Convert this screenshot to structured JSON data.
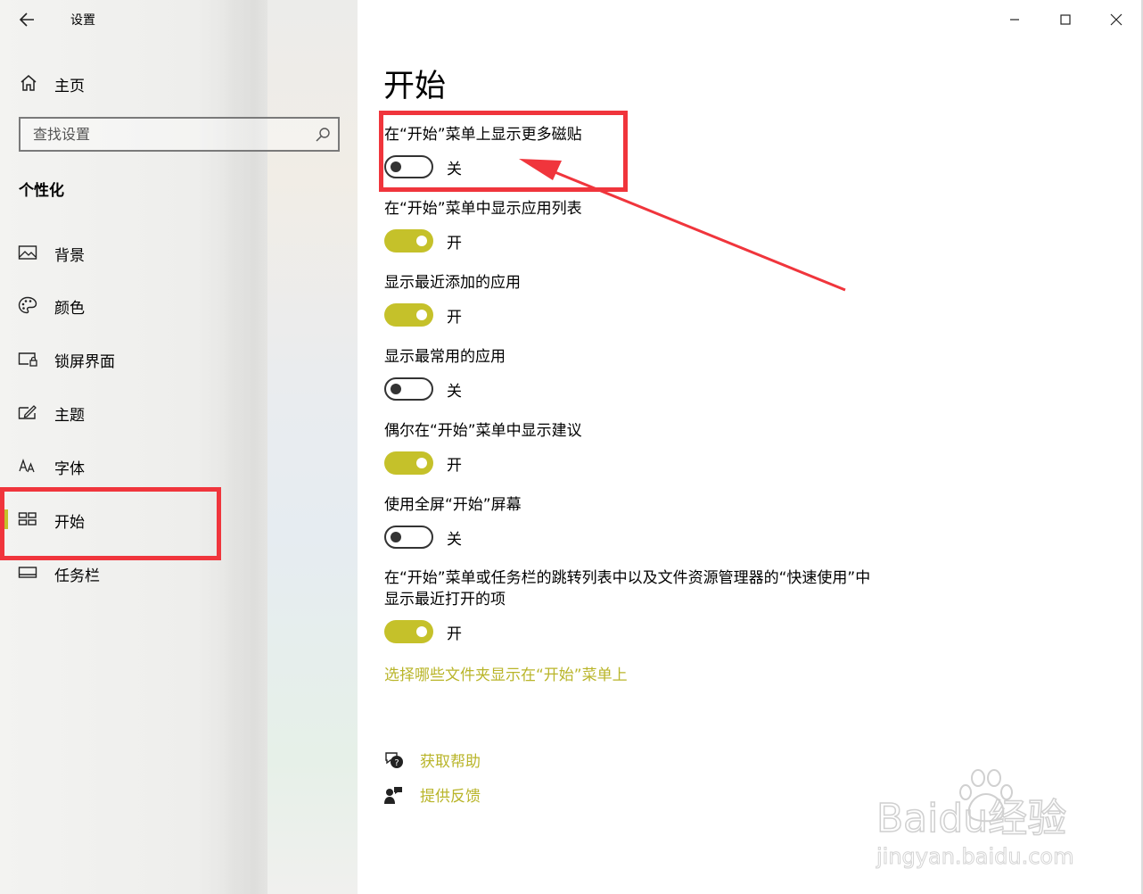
{
  "window": {
    "title": "设置"
  },
  "sidebar": {
    "home_label": "主页",
    "search_placeholder": "查找设置",
    "section_heading": "个性化",
    "items": [
      {
        "label": "背景",
        "icon": "image-icon"
      },
      {
        "label": "颜色",
        "icon": "palette-icon"
      },
      {
        "label": "锁屏界面",
        "icon": "lock-screen-icon"
      },
      {
        "label": "主题",
        "icon": "theme-icon"
      },
      {
        "label": "字体",
        "icon": "font-icon"
      },
      {
        "label": "开始",
        "icon": "start-tiles-icon",
        "active": true
      },
      {
        "label": "任务栏",
        "icon": "taskbar-icon"
      }
    ]
  },
  "main": {
    "title": "开始",
    "settings": [
      {
        "label": "在“开始”菜单上显示更多磁贴",
        "state": "关",
        "on": false
      },
      {
        "label": "在“开始”菜单中显示应用列表",
        "state": "开",
        "on": true
      },
      {
        "label": "显示最近添加的应用",
        "state": "开",
        "on": true
      },
      {
        "label": "显示最常用的应用",
        "state": "关",
        "on": false
      },
      {
        "label": "偶尔在“开始”菜单中显示建议",
        "state": "开",
        "on": true
      },
      {
        "label": "使用全屏“开始”屏幕",
        "state": "关",
        "on": false
      },
      {
        "label_line1": "在“开始”菜单或任务栏的跳转列表中以及文件资源管理器的“快速使用”中",
        "label_line2": "显示最近打开的项",
        "state": "开",
        "on": true
      }
    ],
    "folders_link": "选择哪些文件夹显示在“开始”菜单上",
    "help_label": "获取帮助",
    "feedback_label": "提供反馈"
  },
  "colors": {
    "accent": "#c5c12a",
    "annotation": "#f0353c"
  },
  "watermark": {
    "brand": "Baidu经验",
    "url": "jingyan.baidu.com"
  }
}
